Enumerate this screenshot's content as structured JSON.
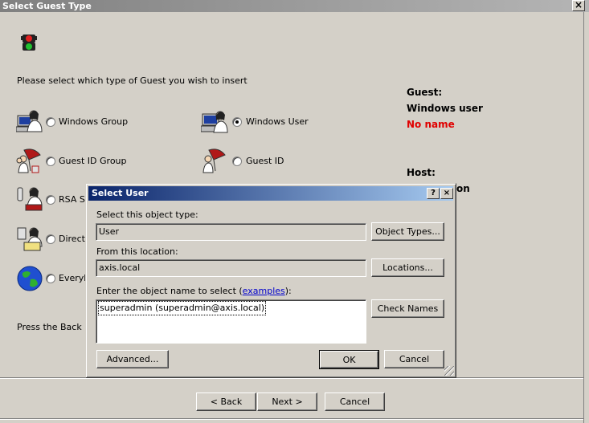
{
  "outer": {
    "title": "Select Guest Type",
    "close_symbol": "×",
    "instruction": "Please select which type of Guest you wish to insert",
    "back_hint": "Press the Back bu",
    "options": [
      {
        "label": "Windows Group",
        "icon": "windows-group-icon",
        "selected": false
      },
      {
        "label": "Windows User",
        "icon": "windows-user-icon",
        "selected": true
      },
      {
        "label": "Guest ID Group",
        "icon": "guest-id-group-icon",
        "selected": false
      },
      {
        "label": "Guest ID",
        "icon": "guest-id-icon",
        "selected": false
      },
      {
        "label": "RSA S",
        "icon": "rsa-icon",
        "selected": false
      },
      {
        "label": "Directo",
        "icon": "directory-icon",
        "selected": false
      },
      {
        "label": "Everyb",
        "icon": "globe-icon",
        "selected": false
      }
    ],
    "side": {
      "guest_heading": "Guest:",
      "guest_type": "Windows user",
      "guest_name": "No name",
      "host_heading": "Host:",
      "host_partial": "on"
    },
    "buttons": {
      "back": "< Back",
      "next": "Next >",
      "cancel": "Cancel"
    }
  },
  "dialog": {
    "title": "Select User",
    "help_symbol": "?",
    "close_symbol": "×",
    "object_type_label": "Select this object type:",
    "object_type_value": "User",
    "object_types_button": "Object Types...",
    "location_label": "From this location:",
    "location_value": "axis.local",
    "locations_button": "Locations...",
    "enter_label_prefix": "Enter the object name to select (",
    "examples_link": "examples",
    "enter_label_suffix": "):",
    "entered_value": "superadmin (superadmin@axis.local)",
    "check_names_button": "Check Names",
    "advanced_button": "Advanced...",
    "ok_button": "OK",
    "cancel_button": "Cancel"
  },
  "colors": {
    "window_bg": "#d4d0c8",
    "dialog_title_start": "#0a246a",
    "dialog_title_end": "#a6caf0",
    "no_name_red": "#e00000",
    "link_blue": "#0000cc"
  }
}
